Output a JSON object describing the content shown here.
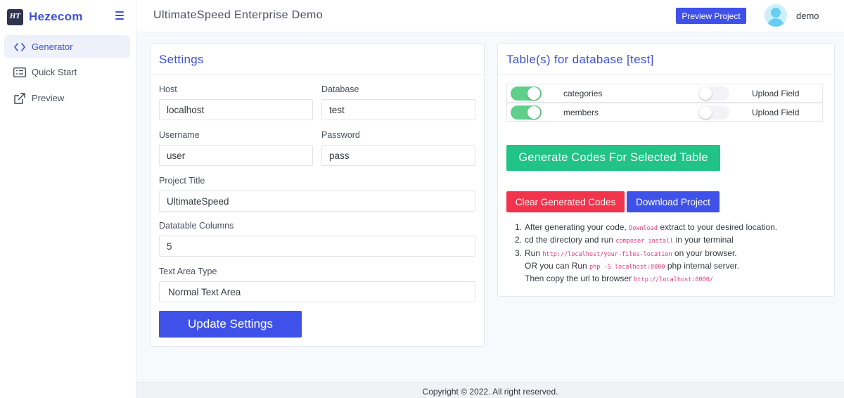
{
  "brand": {
    "logo_text": "HT",
    "name": "Hezecom"
  },
  "sidebar": {
    "items": [
      {
        "label": "Generator",
        "icon": "code-icon",
        "active": true
      },
      {
        "label": "Quick Start",
        "icon": "list-icon",
        "active": false
      },
      {
        "label": "Preview",
        "icon": "external-link-icon",
        "active": false
      }
    ]
  },
  "header": {
    "title": "UltimateSpeed Enterprise Demo",
    "preview_button": "Preview Project",
    "user_name": "demo"
  },
  "settings": {
    "title": "Settings",
    "host_label": "Host",
    "host_value": "localhost",
    "database_label": "Database",
    "database_value": "test",
    "username_label": "Username",
    "username_value": "user",
    "password_label": "Password",
    "password_value": "pass",
    "project_title_label": "Project Title",
    "project_title_value": "UltimateSpeed",
    "datatable_columns_label": "Datatable Columns",
    "datatable_columns_value": "5",
    "text_area_type_label": "Text Area Type",
    "text_area_type_value": "Normal Text Area",
    "update_button": "Update Settings"
  },
  "tables": {
    "title": "Table(s) for database [test]",
    "rows": [
      {
        "name": "categories",
        "selected": true,
        "upload_enabled": false,
        "upload_label": "Upload Field"
      },
      {
        "name": "members",
        "selected": true,
        "upload_enabled": false,
        "upload_label": "Upload Field"
      }
    ],
    "generate_button": "Generate Codes For Selected Table",
    "clear_button": "Clear Generated Codes",
    "download_button": "Download Project"
  },
  "instructions": {
    "n1": "1.",
    "l1_a": "After generating your code, ",
    "l1_code": "Download",
    "l1_b": " extract to your desired location.",
    "n2": "2.",
    "l2_a": "cd the directory and run ",
    "l2_code": "composer install",
    "l2_b": " in your terminal",
    "n3": "3.",
    "l3_a": "Run ",
    "l3_code": "http://localhost/your-files-location",
    "l3_b": " on your browser.",
    "l4_a": "OR you can Run ",
    "l4_code": "php -S localhost:8000",
    "l4_b": " php internal server.",
    "l5_a": "Then copy the url to browser ",
    "l5_code": "http://localhost:8000/"
  },
  "footer": {
    "text": "Copyright © 2022. All right reserved."
  },
  "colors": {
    "primary": "#3f51e8",
    "success": "#21c387",
    "danger": "#f1334c",
    "toggle_on": "#5fcf8a"
  }
}
